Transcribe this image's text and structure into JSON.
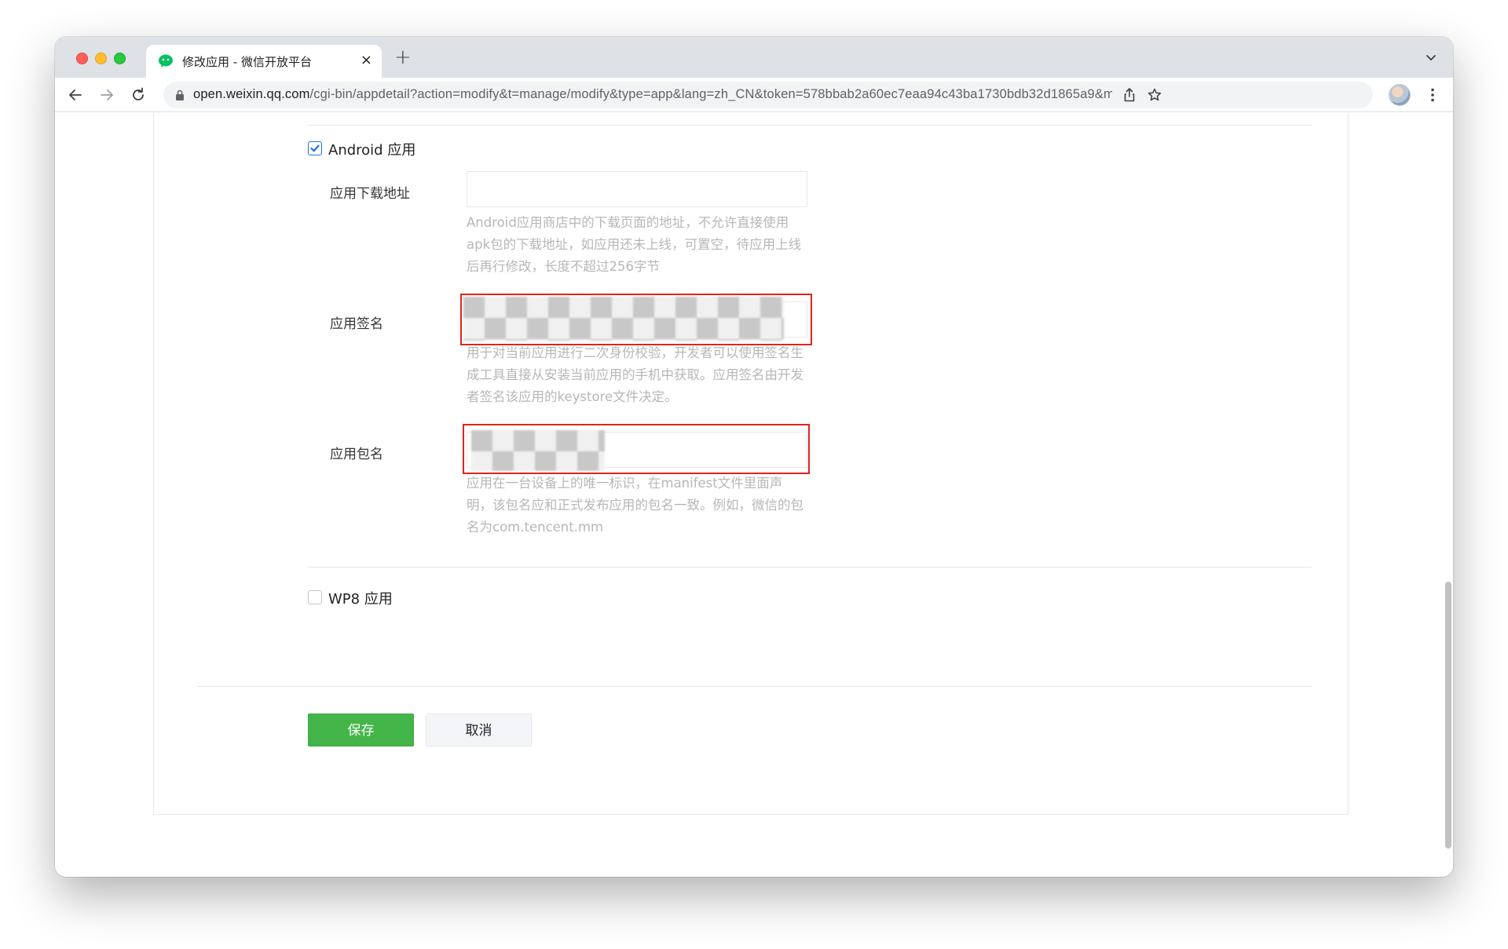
{
  "browser": {
    "tab_title": "修改应用 - 微信开放平台",
    "tab_close": "×",
    "new_tab": "+",
    "url_host": "open.weixin.qq.com",
    "url_path": "/cgi-bin/appdetail?action=modify&t=manage/modify&type=app&lang=zh_CN&token=578bbab2a60ec7eaa94c43ba1730bdb32d1865a9&modifytype=..."
  },
  "form": {
    "android_label": "Android 应用",
    "android_checked": true,
    "download_url_label": "应用下载地址",
    "download_url_value": "",
    "download_url_tip": "Android应用商店中的下载页面的地址，不允许直接使用apk包的下载地址，如应用还未上线，可置空，待应用上线后再行修改，长度不超过256字节",
    "signature_label": "应用签名",
    "signature_tip": "用于对当前应用进行二次身份校验，开发者可以使用签名生成工具直接从安装当前应用的手机中获取。应用签名由开发者签名该应用的keystore文件决定。",
    "package_label": "应用包名",
    "package_tip": "应用在一台设备上的唯一标识，在manifest文件里面声明，该包名应和正式发布应用的包名一致。例如，微信的包名为com.tencent.mm",
    "wp8_label": "WP8 应用",
    "wp8_checked": false
  },
  "actions": {
    "save_label": "保存",
    "cancel_label": "取消"
  },
  "colors": {
    "primary_green": "#44b549",
    "redaction_red": "#e0251b",
    "wechat_green": "#07c160"
  }
}
